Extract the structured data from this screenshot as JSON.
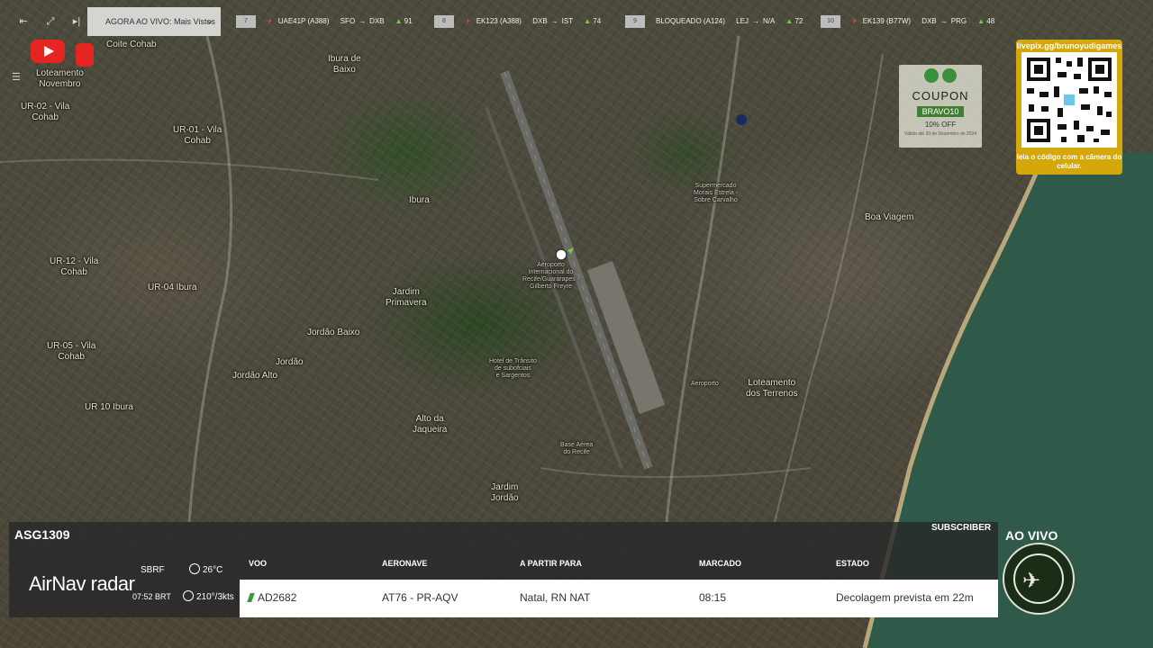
{
  "controls": {
    "collapse_icon": "collapse-left-icon",
    "expand_icon": "expand-icon",
    "next_icon": "skip-next-icon",
    "list_icon": "list-icon"
  },
  "now_live": {
    "label": "AGORA AO VIVO: Mais Vistos"
  },
  "ticker": [
    {
      "rank": "7",
      "title": "UAE41P (A388)",
      "from": "SFO",
      "to": "DXB",
      "signal": "91"
    },
    {
      "rank": "8",
      "title": "EK123 (A388)",
      "from": "DXB",
      "to": "IST",
      "signal": "74"
    },
    {
      "rank": "9",
      "title": "BLOQUEADO (A124)",
      "from": "LEJ",
      "to": "N/A",
      "signal": "72"
    },
    {
      "rank": "10",
      "title": "EK139 (B77W)",
      "from": "DXB",
      "to": "PRG",
      "signal": "48"
    }
  ],
  "youtube": {
    "badge": ""
  },
  "coupon": {
    "word": "COUPON",
    "code": "BRAVO10",
    "sub": "10% OFF",
    "fine": "Válido até 30 de Dezembro de 2024"
  },
  "qr": {
    "url": "livepix.gg/brunoyudigames",
    "caption": "leia o código com a câmera do celular."
  },
  "map_labels": [
    {
      "text": "Ibura de\nBaixo",
      "cls": ""
    },
    {
      "text": "UR-01 - Vila\nCohab",
      "cls": ""
    },
    {
      "text": "UR-02 - Vila\nCohab",
      "cls": ""
    },
    {
      "text": "Loteamento\nNovembro",
      "cls": ""
    },
    {
      "text": "Ibura",
      "cls": ""
    },
    {
      "text": "UR-12 - Vila\nCohab",
      "cls": ""
    },
    {
      "text": "UR-04 Ibura",
      "cls": ""
    },
    {
      "text": "UR-05 - Vila\nCohab",
      "cls": ""
    },
    {
      "text": "UR 10 Ibura",
      "cls": ""
    },
    {
      "text": "Jordão Baixo",
      "cls": ""
    },
    {
      "text": "Jardim\nPrimavera",
      "cls": ""
    },
    {
      "text": "Jordão",
      "cls": ""
    },
    {
      "text": "Jordão Alto",
      "cls": ""
    },
    {
      "text": "Alto da\nJaqueira",
      "cls": ""
    },
    {
      "text": "Jardim\nJordão",
      "cls": ""
    },
    {
      "text": "Aeroporto\nInternacional do\nRecife/Guararapes -\nGilberto Freyre",
      "cls": "small"
    },
    {
      "text": "Hotel de Trânsito\nde subofciais\ne Sargentos",
      "cls": "small"
    },
    {
      "text": "Base Aérea\ndo Recife",
      "cls": "small"
    },
    {
      "text": "Boa Viagem",
      "cls": ""
    },
    {
      "text": "Loteamento\ndos Terrenos",
      "cls": ""
    },
    {
      "text": "Aeroporto",
      "cls": "small"
    },
    {
      "text": "Supermercado\nMorais Estrela -\nSobre Carvalho",
      "cls": "small"
    },
    {
      "text": "Coite Cohab",
      "cls": ""
    }
  ],
  "flight": {
    "callsign": "ASG1309",
    "subscriber": "SUBSCRIBER",
    "brand": "AirNav radar",
    "airport": "SBRF",
    "local_time": "07:52 BRT",
    "temperature": "26°C",
    "wind": "210°/3kts",
    "headers": {
      "flight": "VOO",
      "aircraft": "AERONAVE",
      "route": "A PARTIR PARA",
      "scheduled": "MARCADO",
      "status": "ESTADO"
    },
    "row": {
      "flight": "AD2682",
      "aircraft": "AT76 - PR-AQV",
      "route": "Natal, RN NAT",
      "scheduled": "08:15",
      "status": "Decolagem prevista em 22m"
    }
  },
  "live": {
    "label": "AO VIVO"
  },
  "colors": {
    "ocean": "#2f5a4a",
    "accent_yellow": "#d4a80a",
    "youtube_red": "#e52521",
    "signal_green": "#7ec94a"
  }
}
